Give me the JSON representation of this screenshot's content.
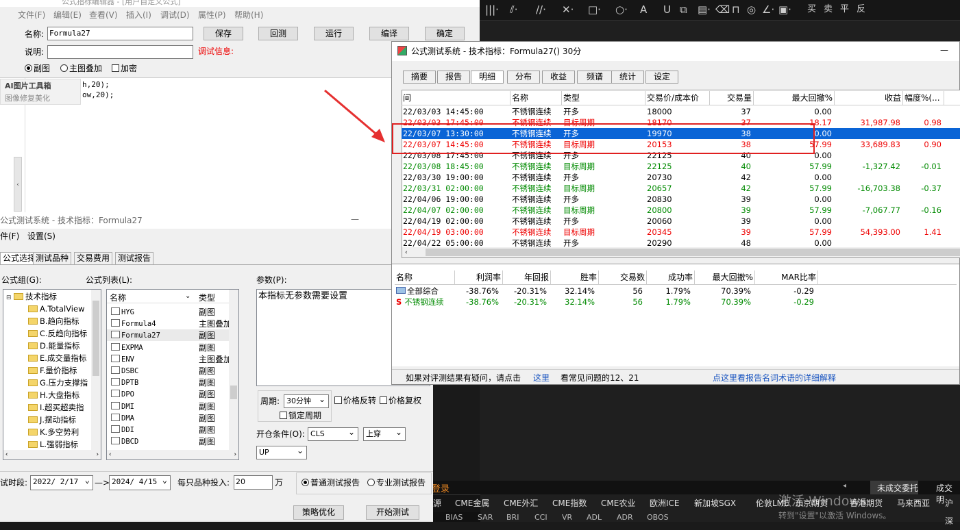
{
  "editor": {
    "title": "公式指标编辑器 - [用户自定义公式]",
    "menu": [
      "文件(F)",
      "编辑(E)",
      "查看(V)",
      "插入(I)",
      "调试(D)",
      "属性(P)",
      "帮助(H)"
    ],
    "name_label": "名称:",
    "name_value": "Formula27",
    "desc_label": "说明:",
    "desc_value": "",
    "debug_label": "调试信息:",
    "buttons": [
      "保存",
      "回测",
      "运行",
      "编译",
      "确定"
    ],
    "radio_sub": "副图",
    "radio_main": "主图叠加",
    "encrypt": "加密",
    "code_lines": [
      "h,20);",
      "ow,20);"
    ],
    "ai_tool": "AI图片工具箱",
    "ai_sub": "图像修复美化"
  },
  "config": {
    "title": "公式测试系统 - 技术指标：Formula27",
    "menu": [
      "件(F)",
      "设置(S)"
    ],
    "tabs": [
      "公式选择",
      "测试品种",
      "交易费用",
      "测试报告"
    ],
    "group_label": "公式组(G):",
    "list_label": "公式列表(L):",
    "param_label": "参数(P):",
    "groups": [
      "技术指标",
      "A.TotalView",
      "B.趋向指标",
      "C.反趋向指标",
      "D.能量指标",
      "E.成交量指标",
      "F.量价指标",
      "G.压力支撑指",
      "H.大盘指标",
      "I.超买超卖指",
      "J.摆动指标",
      "K.多空势利",
      "L.强弱指标"
    ],
    "list_headers": [
      "名称",
      "类型"
    ],
    "formulas": [
      {
        "n": "HYG",
        "t": "副图"
      },
      {
        "n": "Formula4",
        "t": "主图叠加"
      },
      {
        "n": "Formula27",
        "t": "副图"
      },
      {
        "n": "EXPMA",
        "t": "副图"
      },
      {
        "n": "ENV",
        "t": "主图叠加"
      },
      {
        "n": "DSBC",
        "t": "副图"
      },
      {
        "n": "DPTB",
        "t": "副图"
      },
      {
        "n": "DPO",
        "t": "副图"
      },
      {
        "n": "DMI",
        "t": "副图"
      },
      {
        "n": "DMA",
        "t": "副图"
      },
      {
        "n": "DDI",
        "t": "副图"
      },
      {
        "n": "DBCD",
        "t": "副图"
      }
    ],
    "param_text": "本指标无参数需要设置",
    "period_label": "周期:",
    "period_value": "30分钟",
    "price_reverse": "价格反转",
    "price_restore": "价格复权",
    "lock_period": "锁定周期",
    "open_label": "开仓条件(O):",
    "open_value": "CLS",
    "cross_value": "上穿",
    "up_value": "UP",
    "period_range_label": "试时段:",
    "date_from": "2022/ 2/17",
    "arrow": "—>",
    "date_to": "2024/ 4/15",
    "invest_label": "每只品种投入:",
    "invest_value": "20",
    "invest_unit": "万",
    "normal_report": "普通测试报告",
    "pro_report": "专业测试报告",
    "strategy_btn": "策略优化",
    "start_btn": "开始测试"
  },
  "tester": {
    "title": "公式测试系统 - 技术指标：Formula27() 30分",
    "tabs": [
      "摘要",
      "报告",
      "明细",
      "分布",
      "收益",
      "频谱",
      "统计",
      "设定"
    ],
    "headers": [
      "间",
      "名称",
      "类型",
      "交易价/成本价",
      "交易量",
      "最大回撤%",
      "收益",
      "幅度%(..."
    ],
    "rows": [
      {
        "time": "22/03/03 14:45:00",
        "name": "不锈钢连续",
        "type": "开多",
        "price": "18000",
        "vol": "37",
        "dd": "0.00",
        "profit": "",
        "pct": "",
        "c": "black"
      },
      {
        "time": "22/03/03 17:45:00",
        "name": "不锈钢连续",
        "type": "目标周期",
        "price": "18170",
        "vol": "37",
        "dd": "18.17",
        "profit": "31,987.98",
        "pct": "0.98",
        "c": "red"
      },
      {
        "time": "22/03/07 13:30:00",
        "name": "不锈钢连续",
        "type": "开多",
        "price": "19970",
        "vol": "38",
        "dd": "0.00",
        "profit": "",
        "pct": "",
        "c": "sel"
      },
      {
        "time": "22/03/07 14:45:00",
        "name": "不锈钢连续",
        "type": "目标周期",
        "price": "20153",
        "vol": "38",
        "dd": "57.99",
        "profit": "33,689.83",
        "pct": "0.90",
        "c": "red"
      },
      {
        "time": "22/03/08 17:45:00",
        "name": "不锈钢连续",
        "type": "开多",
        "price": "22125",
        "vol": "40",
        "dd": "0.00",
        "profit": "",
        "pct": "",
        "c": "black"
      },
      {
        "time": "22/03/08 18:45:00",
        "name": "不锈钢连续",
        "type": "目标周期",
        "price": "22125",
        "vol": "40",
        "dd": "57.99",
        "profit": "-1,327.42",
        "pct": "-0.01",
        "c": "green"
      },
      {
        "time": "22/03/30 19:00:00",
        "name": "不锈钢连续",
        "type": "开多",
        "price": "20730",
        "vol": "42",
        "dd": "0.00",
        "profit": "",
        "pct": "",
        "c": "black"
      },
      {
        "time": "22/03/31 02:00:00",
        "name": "不锈钢连续",
        "type": "目标周期",
        "price": "20657",
        "vol": "42",
        "dd": "57.99",
        "profit": "-16,703.38",
        "pct": "-0.37",
        "c": "green"
      },
      {
        "time": "22/04/06 19:00:00",
        "name": "不锈钢连续",
        "type": "开多",
        "price": "20830",
        "vol": "39",
        "dd": "0.00",
        "profit": "",
        "pct": "",
        "c": "black"
      },
      {
        "time": "22/04/07 02:00:00",
        "name": "不锈钢连续",
        "type": "目标周期",
        "price": "20800",
        "vol": "39",
        "dd": "57.99",
        "profit": "-7,067.77",
        "pct": "-0.16",
        "c": "green"
      },
      {
        "time": "22/04/19 02:00:00",
        "name": "不锈钢连续",
        "type": "开多",
        "price": "20060",
        "vol": "39",
        "dd": "0.00",
        "profit": "",
        "pct": "",
        "c": "black"
      },
      {
        "time": "22/04/19 03:00:00",
        "name": "不锈钢连续",
        "type": "目标周期",
        "price": "20345",
        "vol": "39",
        "dd": "57.99",
        "profit": "54,393.00",
        "pct": "1.41",
        "c": "red"
      },
      {
        "time": "22/04/22 05:00:00",
        "name": "不锈钢连续",
        "type": "开多",
        "price": "20290",
        "vol": "48",
        "dd": "0.00",
        "profit": "",
        "pct": "",
        "c": "black"
      }
    ],
    "sum_headers": [
      "名称",
      "利润率",
      "年回报",
      "胜率",
      "交易数",
      "成功率",
      "最大回撤%",
      "MAR比率"
    ],
    "sum_rows": [
      {
        "name": "全部综合",
        "v": [
          "-38.76%",
          "-20.31%",
          "32.14%",
          "56",
          "1.79%",
          "70.39%",
          "-0.29"
        ]
      },
      {
        "name": "不锈钢连续",
        "v": [
          "-38.76%",
          "-20.31%",
          "32.14%",
          "56",
          "1.79%",
          "70.39%",
          "-0.29"
        ]
      }
    ],
    "footer_text": "如果对评测结果有疑问，请点击",
    "footer_link": "这里",
    "footer_text2": "看常见问题的12、21",
    "footer_link2": "点这里看报告名词术语的详细解释"
  },
  "dark": {
    "toolbar": [
      "买",
      "卖",
      "平",
      "反"
    ],
    "tabs": [
      "源",
      "CME金属",
      "CME外汇",
      "CME指数",
      "CME农业",
      "欧洲ICE",
      "新加坡SGX",
      "伦敦LME",
      "东京期货",
      "香港期货",
      "马来西亚",
      "沪深"
    ],
    "login": "登录",
    "pending": "未成交委托",
    "filled": "成交明",
    "watermark1": "激活 Windows",
    "watermark2": "转到\"设置\"以激活 Windows。",
    "bottom": [
      "BIAS",
      "SAR",
      "BRI",
      "CCI",
      "VR",
      "ADL",
      "ADR",
      "OBOS"
    ]
  }
}
